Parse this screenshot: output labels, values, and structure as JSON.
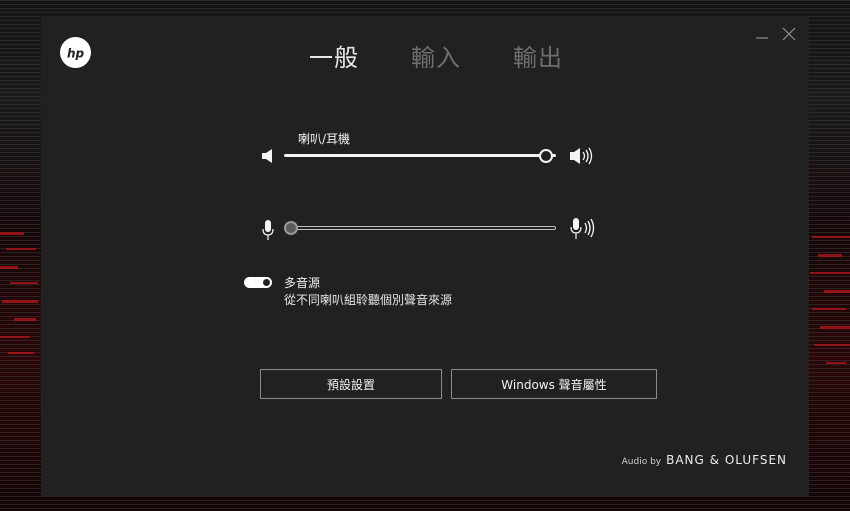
{
  "window": {
    "logo_text": "hp",
    "controls": {
      "minimize_icon": "minimize-icon",
      "close_icon": "close-icon"
    }
  },
  "tabs": [
    {
      "label": "一般",
      "active": true
    },
    {
      "label": "輸入",
      "active": false
    },
    {
      "label": "輸出",
      "active": false
    }
  ],
  "speaker": {
    "label": "喇叭/耳機",
    "volume_fraction": 0.99,
    "icons": [
      "speaker-low-icon",
      "speaker-high-icon"
    ]
  },
  "microphone": {
    "volume_fraction": 0.0,
    "icons": [
      "microphone-low-icon",
      "microphone-high-icon"
    ]
  },
  "multi_stream": {
    "enabled": true,
    "title": "多音源",
    "description": "從不同喇叭組聆聽個別聲音來源"
  },
  "buttons": {
    "defaults": "預設設置",
    "windows_sound": "Windows 聲音屬性"
  },
  "footer": {
    "prefix": "Audio by",
    "brand": "BANG & OLUFSEN"
  },
  "colors": {
    "window_bg": "#212121",
    "accent_text": "#e8e8e8",
    "inactive_tab": "#6e6e6e",
    "backdrop_red": "#a5141a"
  }
}
